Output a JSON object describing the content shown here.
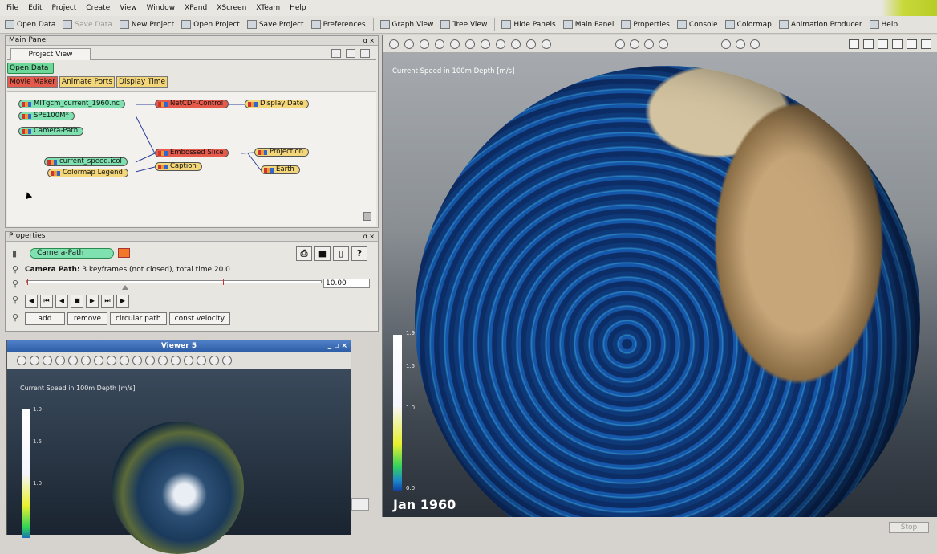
{
  "menu": [
    "File",
    "Edit",
    "Project",
    "Create",
    "View",
    "Window",
    "XPand",
    "XScreen",
    "XTeam",
    "Help"
  ],
  "toolbar": {
    "open_data": "Open Data",
    "save_data": "Save Data",
    "new_project": "New Project",
    "open_project": "Open Project",
    "save_project": "Save Project",
    "preferences": "Preferences",
    "graph_view": "Graph View",
    "tree_view": "Tree View",
    "hide_panels": "Hide Panels",
    "main_panel": "Main Panel",
    "properties": "Properties",
    "console": "Console",
    "colormap": "Colormap",
    "animation_producer": "Animation Producer",
    "help": "Help"
  },
  "main_panel": {
    "title": "Main Panel",
    "tab": "Project View",
    "open_data_btn": "Open Data",
    "buttons": [
      "Movie Maker",
      "Animate Ports",
      "Display Time"
    ],
    "nodes": {
      "mitgcm": "MITgcm_current_1960.nc",
      "spe": "SPE100M*",
      "camera": "Camera-Path",
      "netcdf": "NetCDF-Control",
      "display_date": "Display Date",
      "current_speed": "current_speed.icol",
      "colormap_legend": "Colormap Legend",
      "embossed": "Embossed Slice",
      "caption": "Caption",
      "projection": "Projection",
      "earth": "Earth"
    }
  },
  "properties": {
    "title": "Properties",
    "module": "Camera-Path",
    "info_label": "Camera Path:",
    "info": "3 keyframes (not closed), total time 20.0",
    "time_value": "10.00",
    "help_btn": "?",
    "actions": [
      "add",
      "remove",
      "circular path",
      "const velocity"
    ]
  },
  "viewer5": {
    "title": "Viewer 5",
    "label": "Current Speed in 100m Depth [m/s]",
    "ticks": [
      "1.9",
      "1.5",
      "1.0"
    ]
  },
  "main_viewer": {
    "label": "Current Speed in 100m Depth [m/s]",
    "ticks": [
      "1.9",
      "1.5",
      "1.0",
      "0.0"
    ],
    "date": "Jan 1960"
  },
  "status": {
    "stop": "Stop"
  },
  "colors": {
    "accent": "#2f5ea8",
    "ocean_low": "#0d3fa0",
    "ocean_high": "#e8ef2c"
  }
}
